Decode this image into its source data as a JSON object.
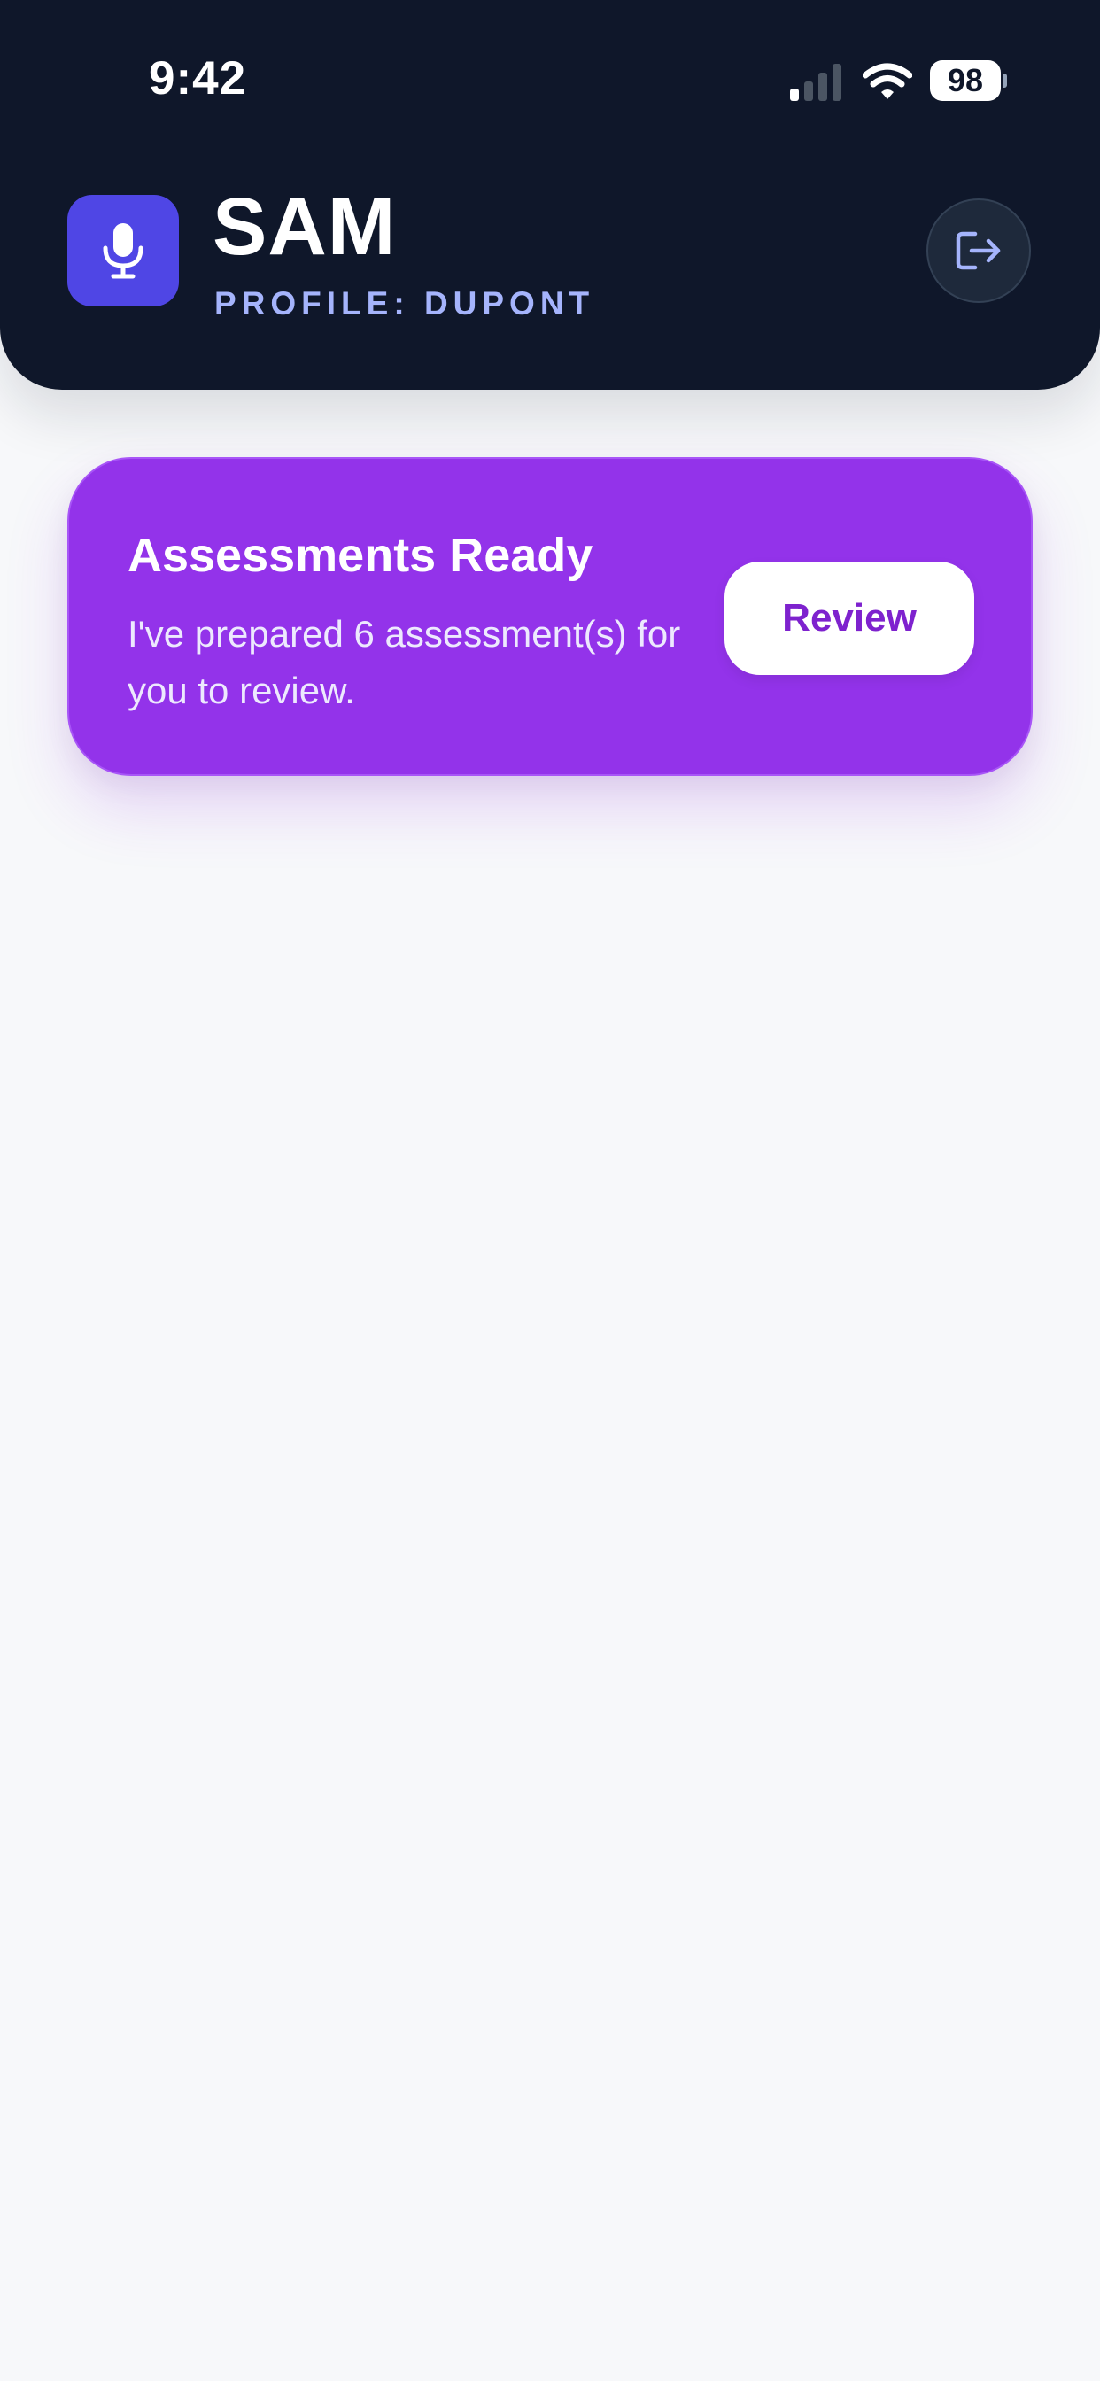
{
  "status_bar": {
    "time": "9:42",
    "battery": "98",
    "icons": [
      "cellular-signal-icon",
      "wifi-icon",
      "battery-icon"
    ]
  },
  "header": {
    "app_title": "SAM",
    "profile_label": "PROFILE: DUPONT",
    "app_icon": "microphone-icon",
    "logout_icon": "logout-icon"
  },
  "notification_card": {
    "title": "Assessments Ready",
    "message": "I've prepared 6 assessment(s) for you to review.",
    "button_label": "Review"
  },
  "colors": {
    "header_background": "#0f172a",
    "app_icon_background": "#4f46e5",
    "profile_label": "#a5b4fc",
    "card_background": "#9333ea",
    "button_text": "#7e22ce",
    "page_background": "#f7f8fa"
  }
}
